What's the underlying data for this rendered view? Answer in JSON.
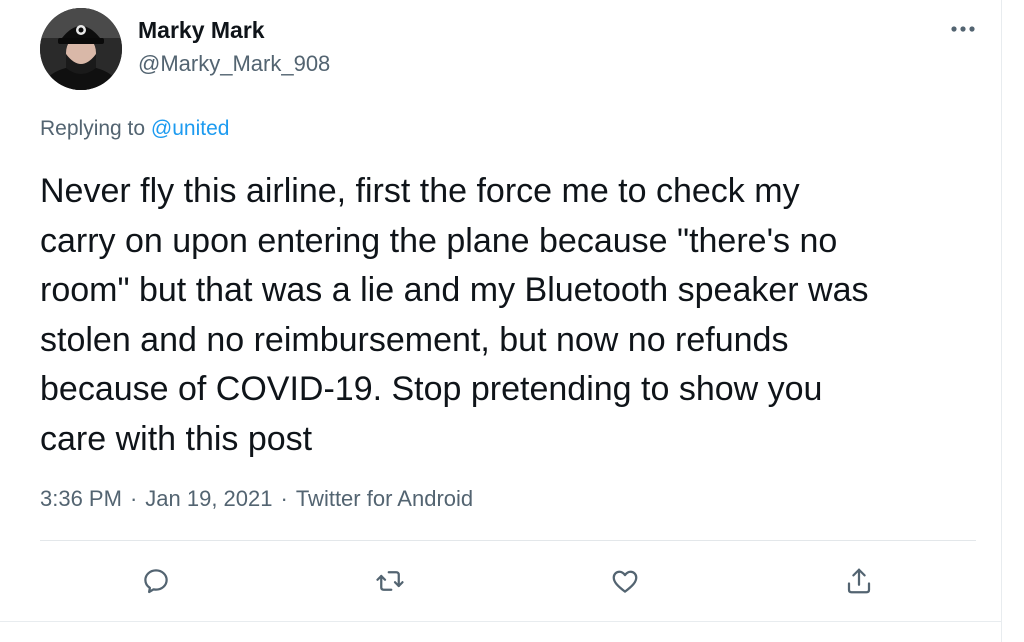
{
  "author": {
    "display_name": "Marky Mark",
    "username": "@Marky_Mark_908"
  },
  "reply_context": {
    "prefix": "Replying to",
    "mention": "@united"
  },
  "tweet": {
    "text": "Never fly this airline, first the force me to check my\ncarry on upon entering the plane because \"there's no\nroom\" but that was a lie and my Bluetooth speaker was\nstolen and no reimbursement, but now no refunds\nbecause of COVID-19. Stop pretending to show you\ncare with this post",
    "time": "3:36 PM",
    "date": "Jan 19, 2021",
    "source": "Twitter for Android",
    "separator": "·"
  },
  "icons": {
    "more": "more-horizontal-icon",
    "reply": "reply-icon",
    "retweet": "retweet-icon",
    "like": "heart-icon",
    "share": "share-icon"
  },
  "colors": {
    "text": "#0f1419",
    "secondary": "#536471",
    "link": "#1d9bf0",
    "border": "#e3e7ea"
  }
}
